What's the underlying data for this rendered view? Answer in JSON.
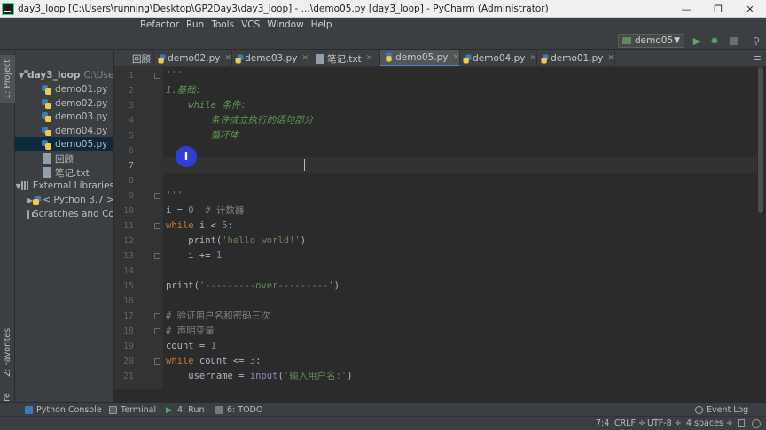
{
  "window": {
    "title": "day3_loop [C:\\Users\\running\\Desktop\\GP2Day3\\day3_loop] - ...\\demo05.py [day3_loop] - PyCharm (Administrator)",
    "minimize_icon": "minimize-icon",
    "maximize_icon": "maximize-icon",
    "close_icon": "close-icon"
  },
  "menu": [
    "Refactor",
    "Run",
    "Tools",
    "VCS",
    "Window",
    "Help"
  ],
  "toolbar": {
    "run_config": "demo05",
    "run_icon": "play-icon",
    "debug_icon": "bug-icon",
    "stop_icon": "stop-icon",
    "search_icon": "search-icon"
  },
  "left_strip": {
    "project": "1: Project",
    "favorites": "2: Favorites",
    "structure": "7: Structure"
  },
  "project_tree": {
    "root": "day3_loop",
    "root_path": "C:\\User",
    "files": [
      "demo01.py",
      "demo02.py",
      "demo03.py",
      "demo04.py",
      "demo05.py",
      "回顾",
      "笔记.txt"
    ],
    "selected": "demo05.py",
    "external_libraries": "External Libraries",
    "python": "< Python 3.7 >",
    "scratches": "Scratches and Con"
  },
  "tabs": [
    {
      "label": "回顾",
      "type": "file"
    },
    {
      "label": "demo02.py",
      "type": "py"
    },
    {
      "label": "demo03.py",
      "type": "py"
    },
    {
      "label": "笔记.txt",
      "type": "txt"
    },
    {
      "label": "demo05.py",
      "type": "py",
      "active": true
    },
    {
      "label": "demo04.py",
      "type": "py"
    },
    {
      "label": "demo01.py",
      "type": "py"
    }
  ],
  "editor": {
    "line_numbers": [
      "1",
      "2",
      "3",
      "4",
      "5",
      "6",
      "7",
      "8",
      "9",
      "10",
      "11",
      "12",
      "13",
      "14",
      "15",
      "16",
      "17",
      "18",
      "19",
      "20",
      "21"
    ],
    "lines": {
      "l1": "'''",
      "l2": "1.基础:",
      "l3": "    while 条件:",
      "l4": "        条件成立执行的语句部分",
      "l5": "        循环体",
      "l9": "'''",
      "l10_a": "i = ",
      "l10_b": "0",
      "l10_c": "  # 计数器",
      "l11_a": "while",
      "l11_b": " i < ",
      "l11_c": "5",
      "l11_d": ":",
      "l12_a": "    print(",
      "l12_b": "'hello world!'",
      "l12_c": ")",
      "l13_a": "    i += ",
      "l13_b": "1",
      "l15_a": "print(",
      "l15_b": "'---------over---------'",
      "l15_c": ")",
      "l17": "# 验证用户名和密码三次",
      "l18": "# 声明变量",
      "l19_a": "count = ",
      "l19_b": "1",
      "l20_a": "while",
      "l20_b": " count <= ",
      "l20_c": "3",
      "l20_d": ":",
      "l21_a": "    username = ",
      "l21_b": "input",
      "l21_c": "(",
      "l21_d": "'输入用户名:'",
      "l21_e": ")"
    },
    "cursor_glyph": "I"
  },
  "bottom_tools": {
    "python_console": "Python Console",
    "terminal": "Terminal",
    "run": "4: Run",
    "todo": "6: TODO",
    "event_log": "Event Log"
  },
  "status": {
    "position": "7:4",
    "line_sep": "CRLF ÷",
    "encoding": "UTF-8 ÷",
    "indent": "4 spaces ÷"
  },
  "colors": {
    "accent": "#4a88c7",
    "docstring": "#629755",
    "keyword": "#cc7832",
    "number": "#6897bb",
    "string": "#6a8759",
    "comment": "#808080"
  }
}
